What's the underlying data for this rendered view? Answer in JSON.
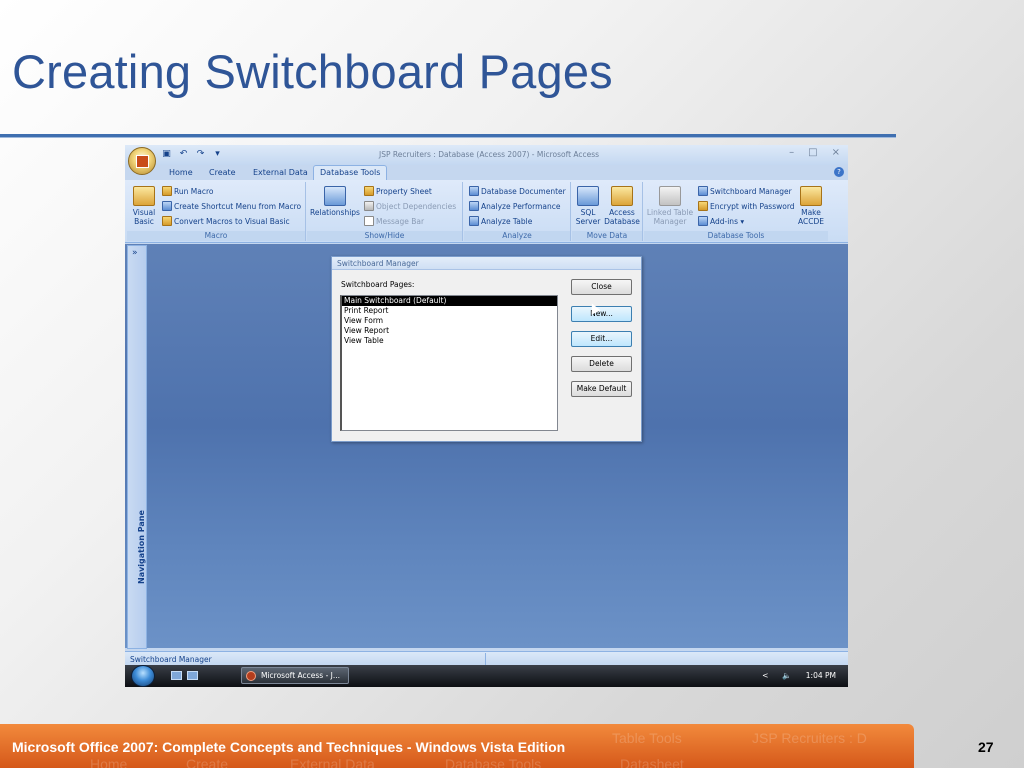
{
  "slide": {
    "title": "Creating Switchboard Pages",
    "footer": "Microsoft Office 2007: Complete Concepts and Techniques - Windows Vista Edition",
    "page_number": "27",
    "footer_ghost": [
      "Home",
      "Create",
      "External Data",
      "Database Tools",
      "Datasheet",
      "Table Tools",
      "JSP Recruiters : D"
    ]
  },
  "window": {
    "title": "JSP Recruiters : Database (Access 2007) - Microsoft Access",
    "qat": {
      "save": "save-icon",
      "undo": "↶",
      "redo": "↷",
      "more": "▾"
    },
    "controls": {
      "minimize": "–",
      "maximize": "□",
      "close": "×"
    },
    "help": "?"
  },
  "tabs": [
    "Home",
    "Create",
    "External Data",
    "Database Tools"
  ],
  "active_tab": "Database Tools",
  "ribbon": {
    "macro": {
      "label": "Macro",
      "visual_basic": "Visual Basic",
      "run_macro": "Run Macro",
      "create_shortcut": "Create Shortcut Menu from Macro",
      "convert_macros": "Convert Macros to Visual Basic"
    },
    "show_hide": {
      "label": "Show/Hide",
      "relationships": "Relationships",
      "property_sheet": "Property Sheet",
      "object_dependencies": "Object Dependencies",
      "message_bar": "Message Bar"
    },
    "analyze": {
      "label": "Analyze",
      "database_documenter": "Database Documenter",
      "analyze_performance": "Analyze Performance",
      "analyze_table": "Analyze Table"
    },
    "move_data": {
      "label": "Move Data",
      "sql_server": "SQL Server",
      "access_database": "Access Database"
    },
    "database_tools": {
      "label": "Database Tools",
      "linked_table_manager": "Linked Table Manager",
      "switchboard_manager": "Switchboard Manager",
      "encrypt": "Encrypt with Password",
      "add_ins": "Add-ins ▾",
      "make_accde": "Make ACCDE"
    }
  },
  "navigation_pane": {
    "label": "Navigation Pane",
    "chevron": "»"
  },
  "dialog": {
    "title": "Switchboard Manager",
    "pages_label": "Switchboard Pages:",
    "pages": [
      "Main Switchboard (Default)",
      "Print Report",
      "View Form",
      "View Report",
      "View Table"
    ],
    "selected_index": 0,
    "buttons": {
      "close": "Close",
      "new": "New...",
      "edit": "Edit...",
      "delete": "Delete",
      "make_default": "Make Default"
    }
  },
  "status_bar": {
    "text": "Switchboard Manager"
  },
  "taskbar": {
    "task": "Microsoft Access - J...",
    "time": "1:04 PM",
    "chevron": "<",
    "volume": "🔈"
  }
}
